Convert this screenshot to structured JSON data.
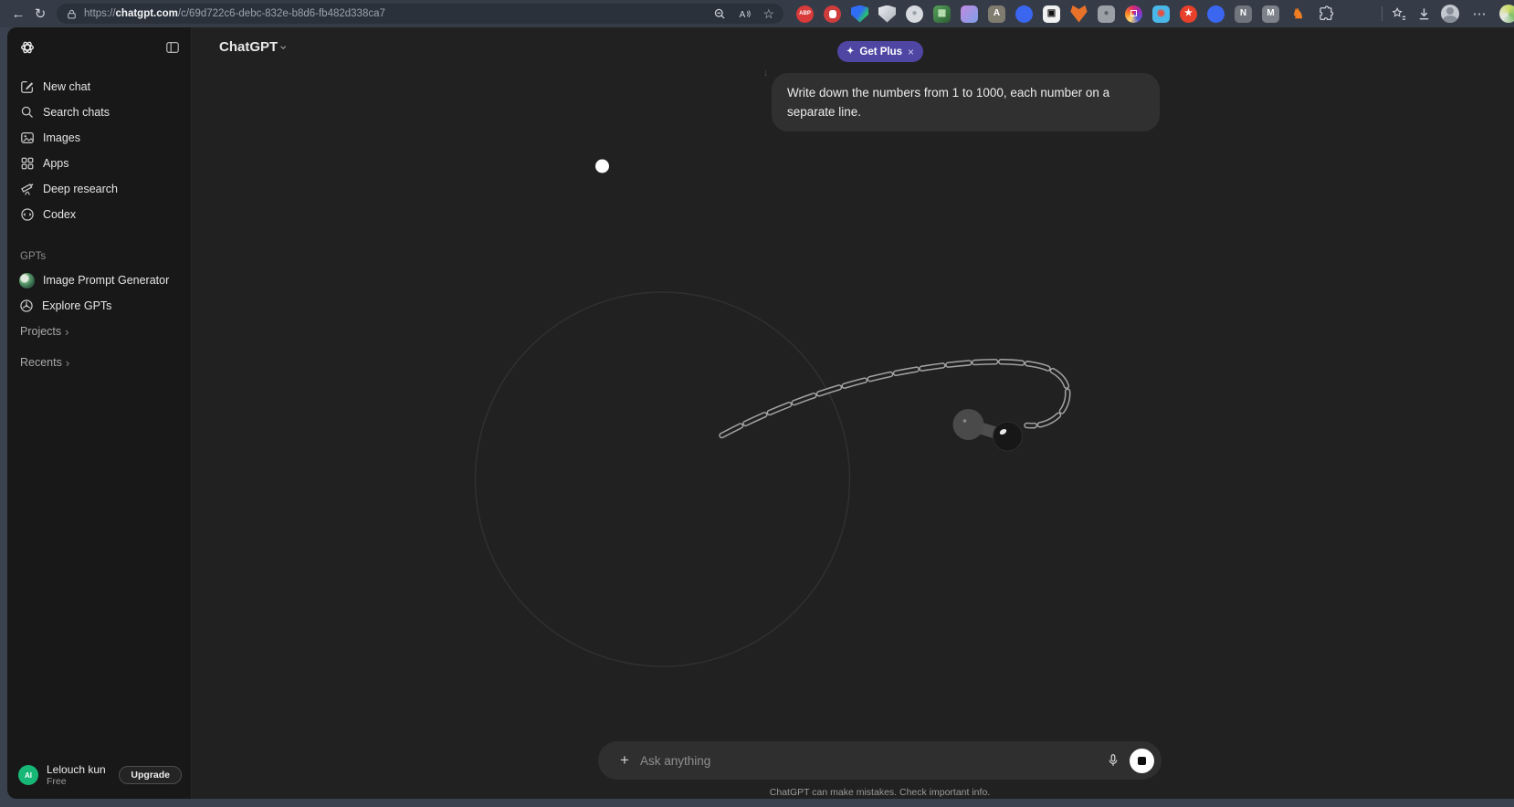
{
  "browser": {
    "url": {
      "scheme": "https://",
      "domain": "chatgpt.com",
      "path": "/c/69d722c6-debc-832e-b8d6-fb482d338ca7"
    },
    "icons": {
      "back": "←",
      "refresh": "↻",
      "star": "☆",
      "more": "⋯"
    },
    "extensions": [
      {
        "name": "adblock-plus",
        "shape": "circle",
        "bg": "#d93a3a",
        "glyph": "ABP",
        "fg": "#fff",
        "small": true
      },
      {
        "name": "adblock-hand",
        "shape": "circle",
        "bg": "#cf3c3c",
        "inner": "blob"
      },
      {
        "name": "shield-blue",
        "shape": "shield",
        "bg": "linear-gradient(125deg,#2f6df5 45%,#27c46b 75%)"
      },
      {
        "name": "shield-gray",
        "shape": "shield",
        "bg": "linear-gradient(135deg,#eceef1,#a9afb8)"
      },
      {
        "name": "badge-light",
        "shape": "circle",
        "bg": "#d7dade",
        "glyph": "●",
        "fg": "#9aa0a8"
      },
      {
        "name": "pixel-green",
        "shape": "square",
        "bg": "linear-gradient(135deg,#55a05a,#2c5e31)",
        "glyph": "▦",
        "fg": "#bfe3b8"
      },
      {
        "name": "gradient-purple",
        "shape": "square",
        "bg": "linear-gradient(135deg,#c18ae0,#7f9fe8)"
      },
      {
        "name": "letter-a-tan",
        "shape": "square",
        "bg": "#807c6f",
        "glyph": "A",
        "fg": "#fff"
      },
      {
        "name": "puzzle-blue",
        "shape": "circle",
        "bg": "#3a66f0"
      },
      {
        "name": "black-frame",
        "shape": "square",
        "bg": "#f1f1f1",
        "glyph": "▣",
        "fg": "#111"
      },
      {
        "name": "metamask-fox",
        "shape": "fox",
        "bg": "#e8722a"
      },
      {
        "name": "camera-gray",
        "shape": "square",
        "bg": "#9aa0a6",
        "glyph": "●",
        "fg": "#5f6368"
      },
      {
        "name": "instagram",
        "shape": "circle",
        "bg": "conic-gradient(from 210deg,#feda75,#fa7e1e,#d62976,#962fbf,#4f5bd5,#feda75)",
        "glyph": "◻",
        "fg": "#fff"
      },
      {
        "name": "cyan-red-dot",
        "shape": "square",
        "bg": "#49b8e8",
        "glyph": "◉",
        "fg": "#e84c3d"
      },
      {
        "name": "red-star",
        "shape": "circle",
        "bg": "#e8402a",
        "glyph": "★",
        "fg": "#fff"
      },
      {
        "name": "puzzle-blue-2",
        "shape": "circle",
        "bg": "#3a66f0"
      },
      {
        "name": "letter-n",
        "shape": "square",
        "bg": "#70757d",
        "glyph": "N",
        "fg": "#fff"
      },
      {
        "name": "letter-m",
        "shape": "square",
        "bg": "#7c818a",
        "glyph": "M",
        "fg": "#fff"
      },
      {
        "name": "orange-figure",
        "shape": "plain",
        "bg": "transparent",
        "glyph": "♞",
        "fg": "#ef7d22"
      },
      {
        "name": "extensions-puzzle",
        "shape": "plain",
        "bg": "transparent",
        "svg": "puzzle"
      }
    ]
  },
  "sidebar": {
    "items": [
      {
        "label": "New chat"
      },
      {
        "label": "Search chats"
      },
      {
        "label": "Images"
      },
      {
        "label": "Apps"
      },
      {
        "label": "Deep research"
      },
      {
        "label": "Codex"
      }
    ],
    "gpts": {
      "label": "GPTs",
      "items": [
        {
          "label": "Image Prompt Generator"
        },
        {
          "label": "Explore GPTs"
        }
      ]
    },
    "projects_label": "Projects",
    "recents_label": "Recents",
    "chevron": "›",
    "profile": {
      "name": "Lelouch kun",
      "plan": "Free",
      "avatar_text": "AI",
      "upgrade_label": "Upgrade"
    }
  },
  "header": {
    "title": "ChatGPT",
    "dropdown_chevron": "›",
    "get_plus": "Get Plus",
    "sparkle": "✦",
    "close": "×",
    "drop_cursor": "↓"
  },
  "chat": {
    "user_message": "Write down the numbers from 1 to 1000, each number on a separate line."
  },
  "composer": {
    "placeholder": "Ask anything",
    "plus": "+"
  },
  "footer": {
    "disclaimer": "ChatGPT can make mistakes. Check important info."
  },
  "colors": {
    "accent_purple": "#4f46a3",
    "avatar_green": "#17b877",
    "toolbar": "#353c48",
    "sidebar_bg": "#181818",
    "main_bg": "#212121",
    "bubble_bg": "#303030",
    "frame": "#3a4250"
  }
}
